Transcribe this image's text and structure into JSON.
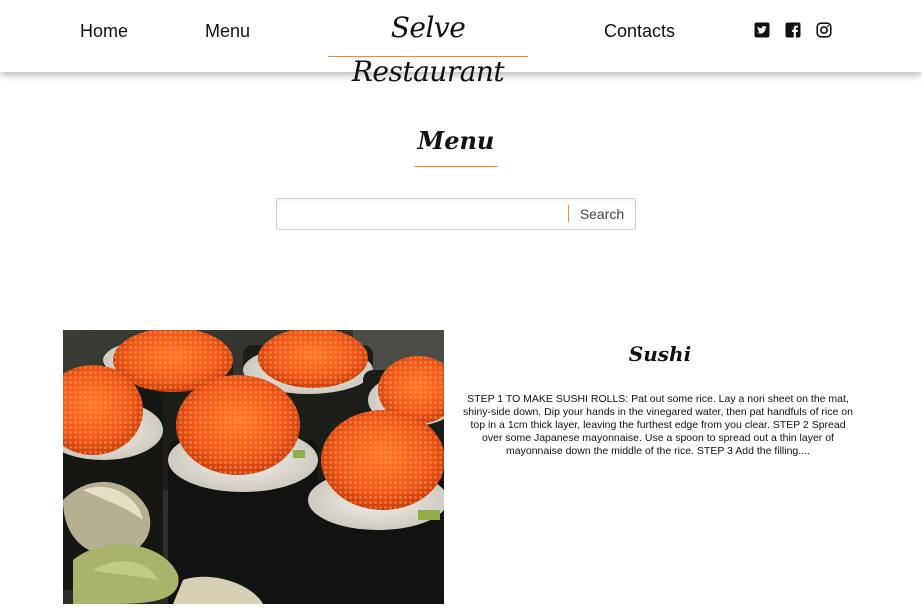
{
  "nav": {
    "home": "Home",
    "menu": "Menu",
    "brand": "Selve Restaurant",
    "contacts": "Contacts",
    "social": [
      "twitter-icon",
      "facebook-icon",
      "instagram-icon"
    ]
  },
  "page": {
    "title": "Menu"
  },
  "search": {
    "placeholder": "",
    "value": "",
    "button_label": "Search"
  },
  "dishes": [
    {
      "title": "Sushi",
      "description": "STEP 1 TO MAKE SUSHI ROLLS: Pat out some rice. Lay a nori sheet on the mat, shiny-side down. Dip your hands in the vinegared water, then pat handfuls of rice on top in a 1cm thick layer, leaving the furthest edge from you clear. STEP 2 Spread over some Japanese mayonnaise. Use a spoon to spread out a thin layer of mayonnaise down the middle of the rice. STEP 3 Add the filling....",
      "image_subject": "sushi rolls topped with orange fish roe"
    }
  ],
  "colors": {
    "accent": "#f08c3a",
    "text": "#111111",
    "background": "#ffffff"
  }
}
